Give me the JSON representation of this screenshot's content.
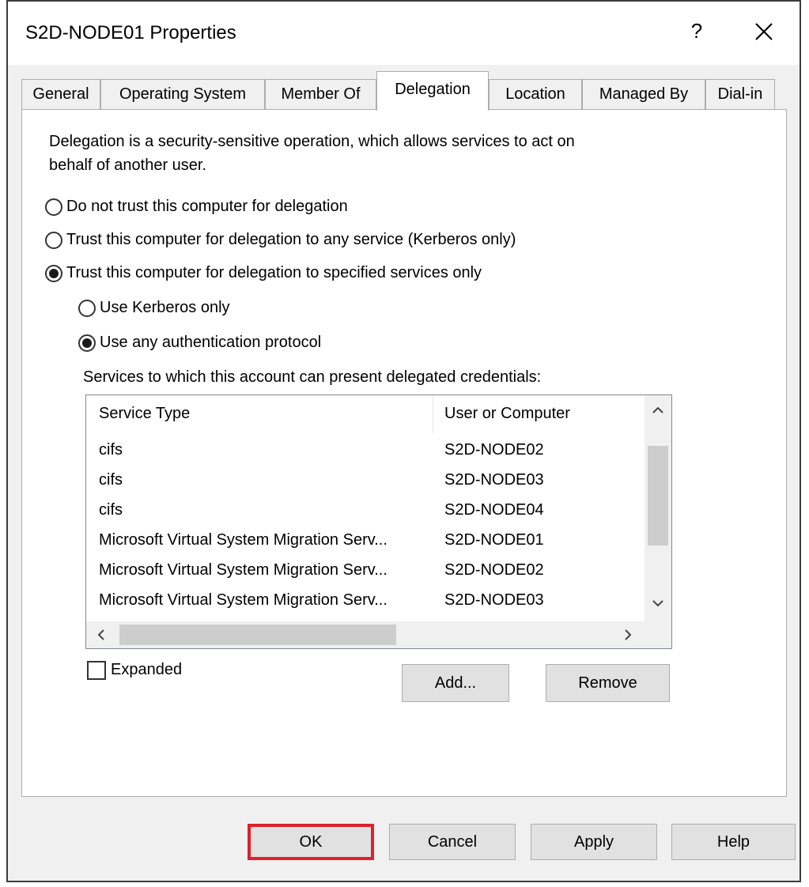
{
  "window": {
    "title": "S2D-NODE01 Properties",
    "help_glyph": "?",
    "close_icon": "close-icon"
  },
  "tabs": [
    {
      "label": "General",
      "active": false
    },
    {
      "label": "Operating System",
      "active": false
    },
    {
      "label": "Member Of",
      "active": false
    },
    {
      "label": "Delegation",
      "active": true
    },
    {
      "label": "Location",
      "active": false
    },
    {
      "label": "Managed By",
      "active": false
    },
    {
      "label": "Dial-in",
      "active": false
    }
  ],
  "delegation": {
    "description_line1": "Delegation is a security-sensitive operation, which allows services to act on",
    "description_line2": "behalf of another user.",
    "options": [
      {
        "label": "Do not trust this computer for delegation",
        "selected": false
      },
      {
        "label": "Trust this computer for delegation to any service (Kerberos only)",
        "selected": false
      },
      {
        "label": "Trust this computer for delegation to specified services only",
        "selected": true
      }
    ],
    "sub_options": [
      {
        "label": "Use Kerberos only",
        "selected": false
      },
      {
        "label": "Use any authentication protocol",
        "selected": true
      }
    ],
    "services_label": "Services to which this account can present delegated credentials:",
    "services_table": {
      "columns": [
        "Service Type",
        "User or Computer"
      ],
      "rows": [
        [
          "cifs",
          "S2D-NODE02"
        ],
        [
          "cifs",
          "S2D-NODE03"
        ],
        [
          "cifs",
          "S2D-NODE04"
        ],
        [
          "Microsoft Virtual System Migration Serv...",
          "S2D-NODE01"
        ],
        [
          "Microsoft Virtual System Migration Serv...",
          "S2D-NODE02"
        ],
        [
          "Microsoft Virtual System Migration Serv...",
          "S2D-NODE03"
        ]
      ]
    },
    "expanded_label": "Expanded",
    "expanded_checked": false,
    "add_label": "Add...",
    "remove_label": "Remove"
  },
  "footer": {
    "ok_label": "OK",
    "cancel_label": "Cancel",
    "apply_label": "Apply",
    "help_label": "Help"
  },
  "colors": {
    "highlight_box": "#e0202d",
    "dialog_bg": "#f0f0f0",
    "button_bg": "#e1e1e1"
  }
}
